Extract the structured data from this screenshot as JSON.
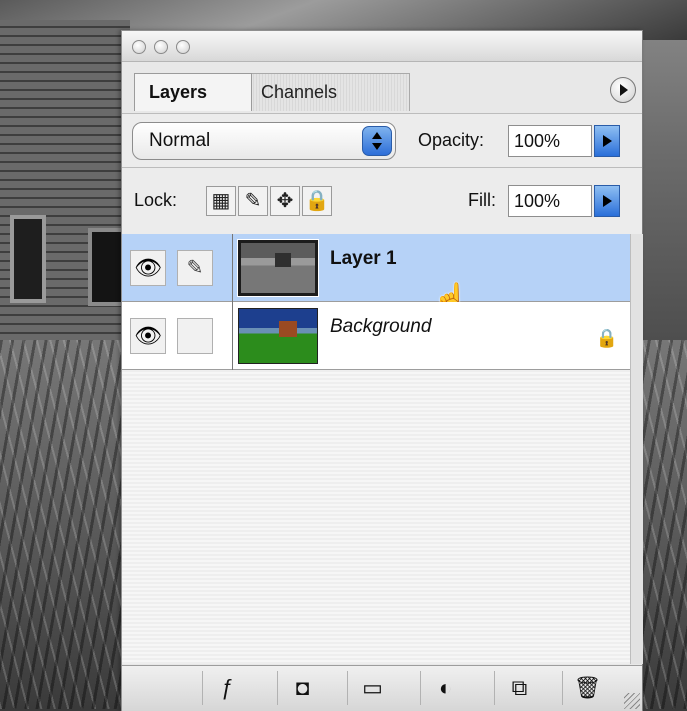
{
  "tabs": [
    {
      "label": "Layers"
    },
    {
      "label": "Channels"
    }
  ],
  "blend_mode": {
    "value": "Normal"
  },
  "opacity": {
    "label": "Opacity:",
    "value": "100%"
  },
  "lock": {
    "label": "Lock:"
  },
  "fill": {
    "label": "Fill:",
    "value": "100%"
  },
  "layers": [
    {
      "name": "Layer 1",
      "selected": true,
      "visible": true,
      "linked": true
    },
    {
      "name": "Background",
      "selected": false,
      "visible": true,
      "locked": true
    }
  ],
  "icons": {
    "visibility": "eye-icon",
    "paintbrush": "brush-icon",
    "lock": "lock-icon",
    "layer_style": "fx-icon",
    "mask": "mask-icon",
    "group": "folder-icon",
    "adjustment": "adjustment-icon",
    "new_layer": "new-layer-icon",
    "delete": "trash-icon"
  },
  "colors": {
    "selection": "#b6d2f7",
    "aqua_blue": "#2d6ed8"
  }
}
